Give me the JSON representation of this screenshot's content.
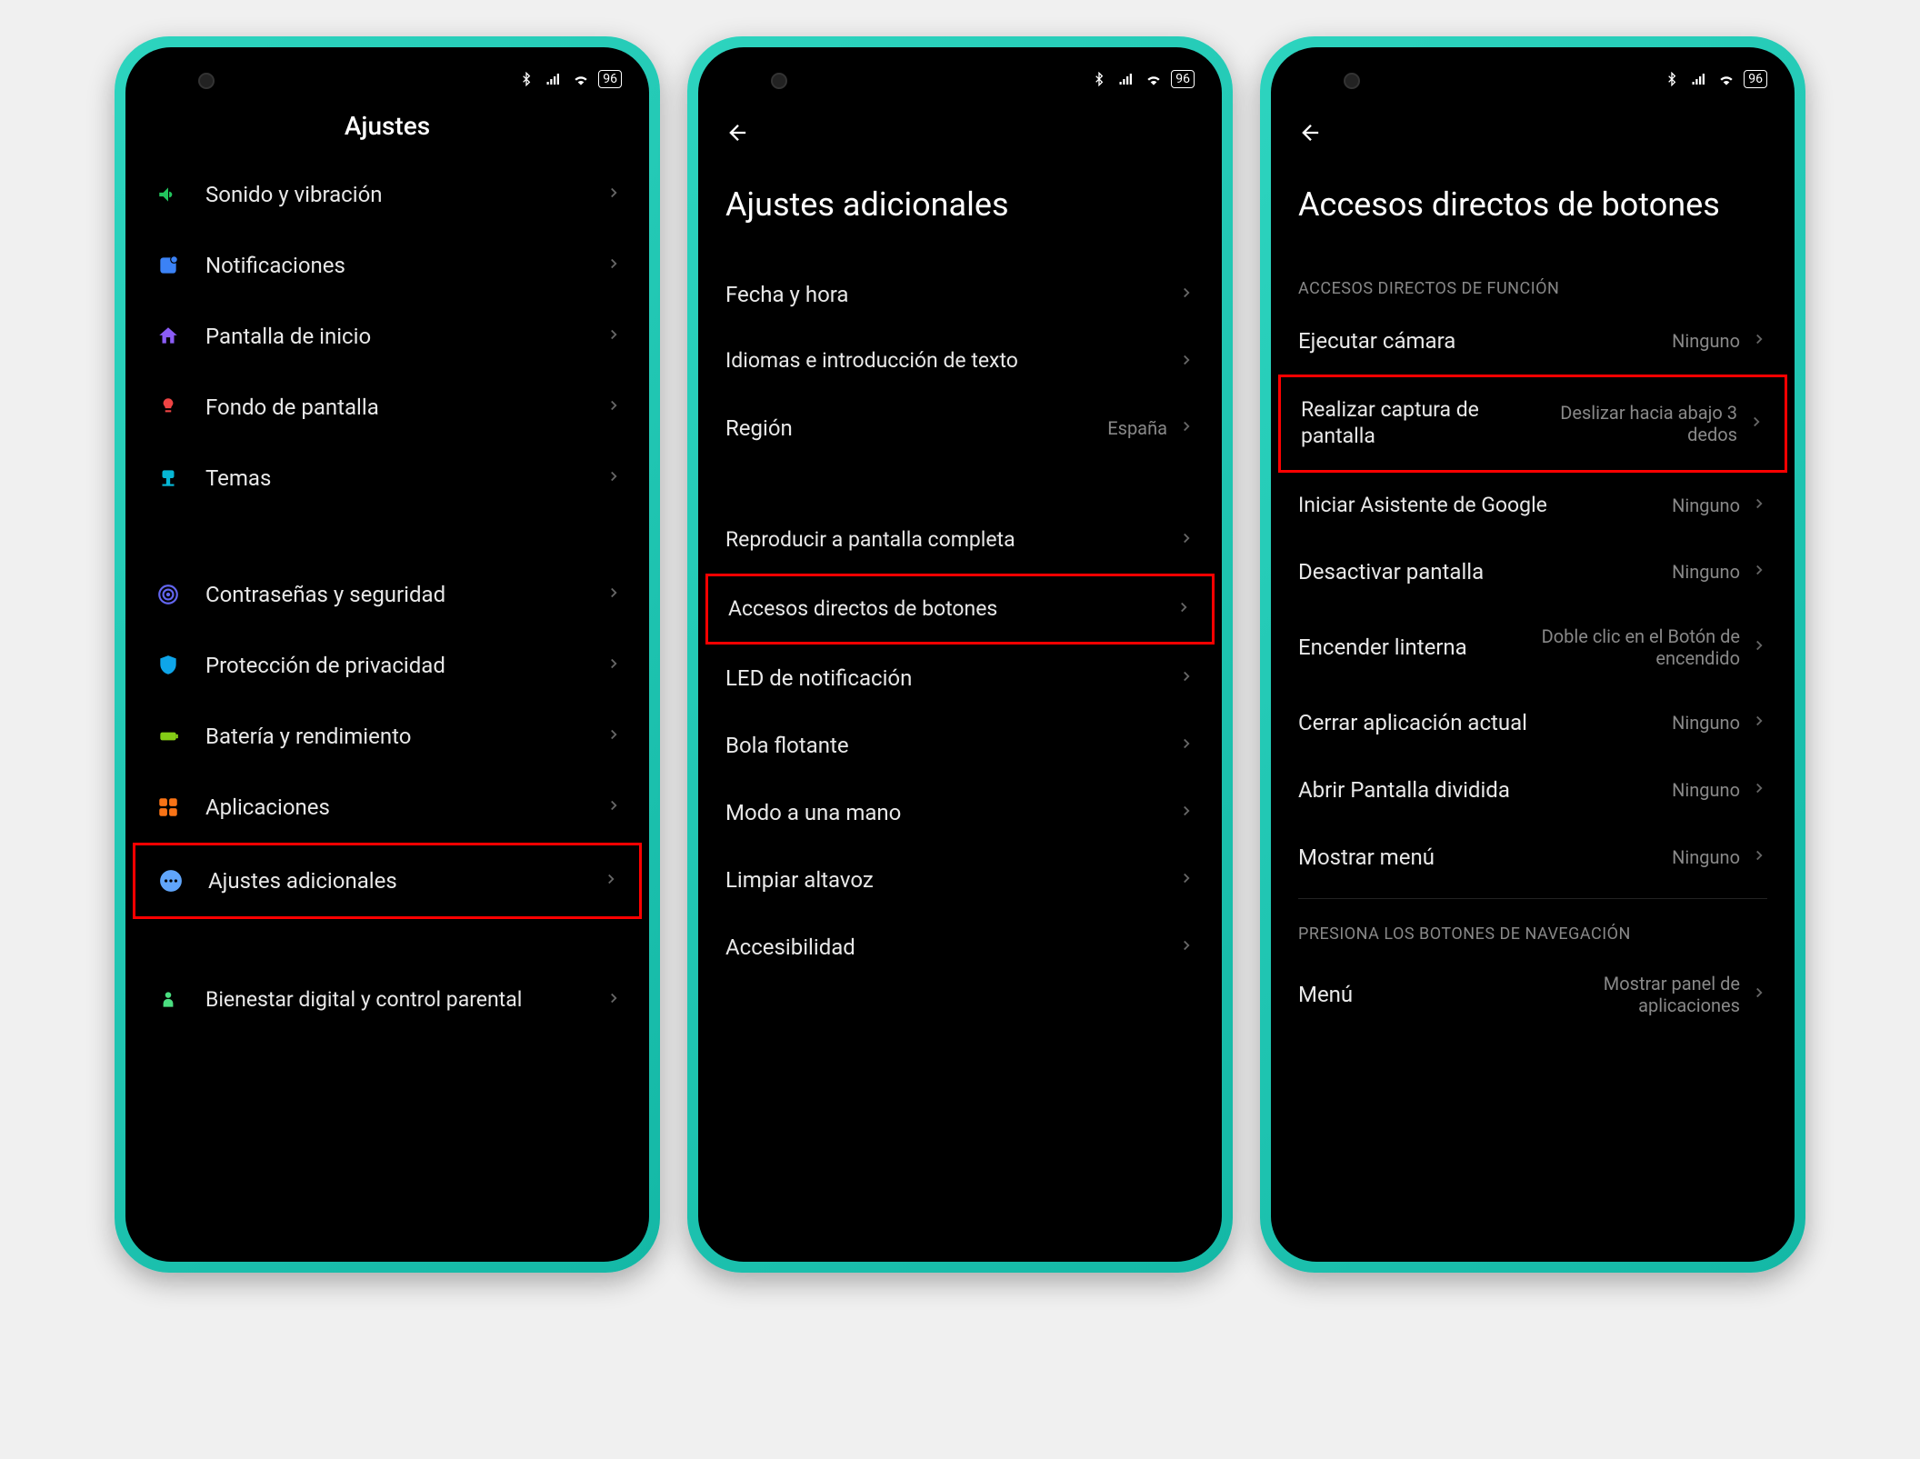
{
  "status_bar": {
    "battery": "96"
  },
  "phone1": {
    "title": "Ajustes",
    "items": [
      {
        "label": "Sonido y vibración",
        "icon": "sound",
        "color": "#22c55e"
      },
      {
        "label": "Notificaciones",
        "icon": "notif",
        "color": "#3b82f6"
      },
      {
        "label": "Pantalla de inicio",
        "icon": "home",
        "color": "#8b5cf6"
      },
      {
        "label": "Fondo de pantalla",
        "icon": "wallpaper",
        "color": "#ef4444"
      },
      {
        "label": "Temas",
        "icon": "themes",
        "color": "#06b6d4"
      }
    ],
    "items2": [
      {
        "label": "Contraseñas y seguridad",
        "icon": "fingerprint",
        "color": "#6366f1"
      },
      {
        "label": "Protección de privacidad",
        "icon": "shield",
        "color": "#0ea5e9"
      },
      {
        "label": "Batería y rendimiento",
        "icon": "battery",
        "color": "#84cc16"
      },
      {
        "label": "Aplicaciones",
        "icon": "apps",
        "color": "#f97316"
      },
      {
        "label": "Ajustes adicionales",
        "icon": "dots",
        "color": "#60a5fa",
        "highlight": true
      }
    ],
    "items3": [
      {
        "label": "Bienestar digital y control parental",
        "icon": "wellbeing",
        "color": "#4ade80"
      }
    ]
  },
  "phone2": {
    "title": "Ajustes adicionales",
    "items": [
      {
        "label": "Fecha y hora"
      },
      {
        "label": "Idiomas e introducción de texto"
      },
      {
        "label": "Región",
        "value": "España"
      }
    ],
    "items2": [
      {
        "label": "Reproducir a pantalla completa"
      },
      {
        "label": "Accesos directos de botones",
        "highlight": true
      },
      {
        "label": "LED de notificación"
      },
      {
        "label": "Bola flotante"
      },
      {
        "label": "Modo a una mano"
      },
      {
        "label": "Limpiar altavoz"
      },
      {
        "label": "Accesibilidad"
      }
    ]
  },
  "phone3": {
    "title": "Accesos directos de botones",
    "section1_header": "ACCESOS DIRECTOS DE FUNCIÓN",
    "items": [
      {
        "label": "Ejecutar cámara",
        "value": "Ninguno"
      },
      {
        "label": "Realizar captura de pantalla",
        "value": "Deslizar hacia abajo 3 dedos",
        "highlight": true
      },
      {
        "label": "Iniciar Asistente de Google",
        "value": "Ninguno"
      },
      {
        "label": "Desactivar pantalla",
        "value": "Ninguno"
      },
      {
        "label": "Encender linterna",
        "value": "Doble clic en el Botón de encendido"
      },
      {
        "label": "Cerrar aplicación actual",
        "value": "Ninguno"
      },
      {
        "label": "Abrir Pantalla dividida",
        "value": "Ninguno"
      },
      {
        "label": "Mostrar menú",
        "value": "Ninguno"
      }
    ],
    "section2_header": "PRESIONA LOS BOTONES DE NAVEGACIÓN",
    "items2": [
      {
        "label": "Menú",
        "value": "Mostrar panel de aplicaciones"
      }
    ]
  }
}
